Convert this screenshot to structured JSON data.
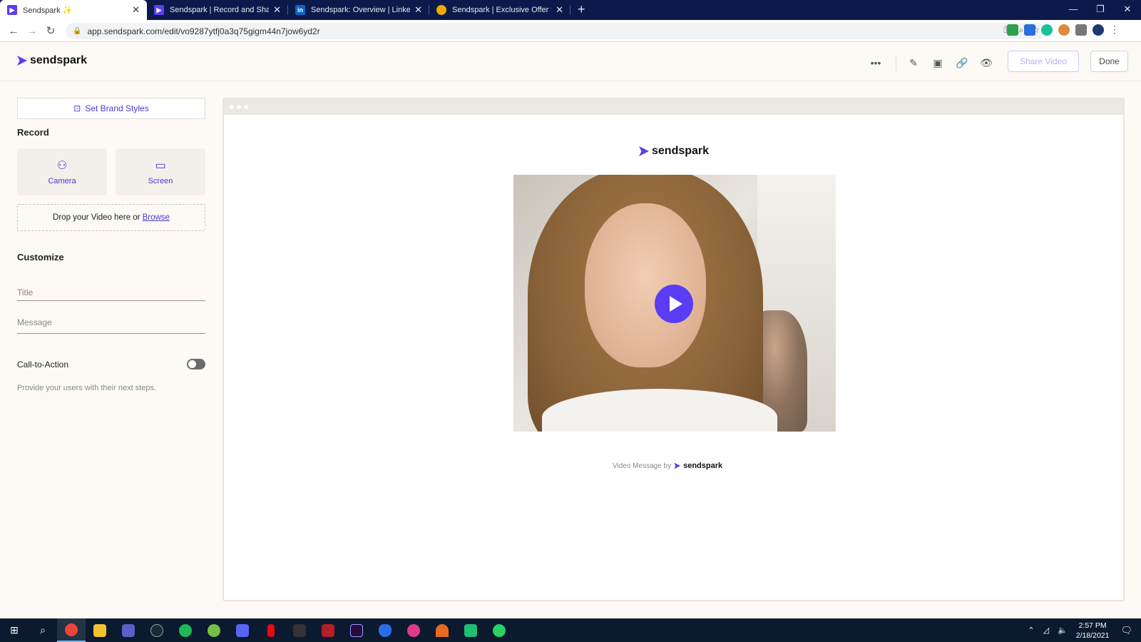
{
  "browser": {
    "tabs": [
      {
        "title": "Sendspark ✨",
        "active": true,
        "favicon": "sendspark-icon",
        "color": "#5b3df5"
      },
      {
        "title": "Sendspark | Record and Share Pe",
        "active": false,
        "favicon": "sendspark-icon",
        "color": "#5b3df5"
      },
      {
        "title": "Sendspark: Overview | LinkedIn",
        "active": false,
        "favicon": "linkedin-icon",
        "color": "#0a66c2"
      },
      {
        "title": "Sendspark | Exclusive Offer from",
        "active": false,
        "favicon": "offer-icon",
        "color": "#f2a900"
      }
    ],
    "new_tab": "+",
    "url": "app.sendspark.com/edit/vo9287ytfj0a3q75gigm44n7jow6yd2r"
  },
  "app": {
    "brand": "sendspark",
    "accent": "#5b3df5",
    "header": {
      "share_label": "Share Video",
      "done_label": "Done"
    }
  },
  "sidebar": {
    "brand_styles_label": "Set Brand Styles",
    "record_title": "Record",
    "camera_label": "Camera",
    "screen_label": "Screen",
    "drop_text": "Drop your Video here or",
    "browse_label": "Browse",
    "customize_title": "Customize",
    "title_placeholder": "Title",
    "message_placeholder": "Message",
    "cta_label": "Call-to-Action",
    "cta_enabled": false,
    "cta_hint": "Provide your users with their next steps."
  },
  "preview": {
    "logo_text": "sendspark",
    "footer_text": "Video Message by",
    "footer_brand": "sendspark"
  },
  "taskbar": {
    "time": "2:57 PM",
    "date": "2/18/2021"
  }
}
